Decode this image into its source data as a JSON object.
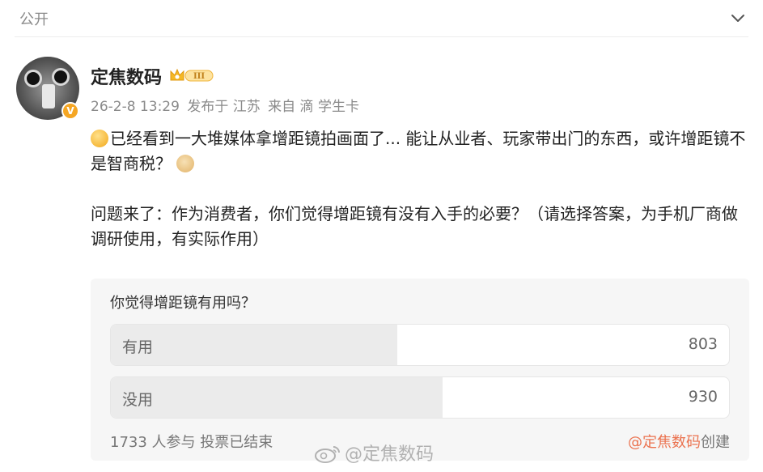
{
  "header": {
    "visibility": "公开"
  },
  "user": {
    "name": "定焦数码",
    "level": "III",
    "verified_badge": "V"
  },
  "meta": {
    "time": "26-2-8 13:29",
    "location": "发布于 江苏",
    "source": "来自 滴 学生卡"
  },
  "post": {
    "line1": "已经看到一大堆媒体拿增距镜拍画面了... 能让从业者、玩家带出门的东西，或许增距镜不是智商税？",
    "line2": "问题来了：作为消费者，你们觉得增距镜有没有入手的必要？（请选择答案，为手机厂商做调研使用，有实际作用）"
  },
  "poll": {
    "question": "你觉得增距镜有用吗？",
    "options": [
      {
        "label": "有用",
        "count": "803",
        "share": 0.4634
      },
      {
        "label": "没用",
        "count": "930",
        "share": 0.5366
      }
    ],
    "summary": "1733 人参与 投票已结束",
    "creator_mention": "@定焦数码",
    "creator_suffix": "创建"
  },
  "watermark": {
    "text": "@定焦数码"
  },
  "colors": {
    "accent": "#eb7350",
    "gold": "#f5a623"
  }
}
